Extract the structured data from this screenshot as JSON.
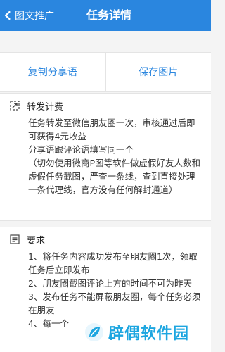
{
  "header": {
    "back_label": "图文推广",
    "title": "任务详情"
  },
  "actions": {
    "copy_label": "复制分享语",
    "save_label": "保存图片"
  },
  "fee_section": {
    "title": "转发计费",
    "lines": [
      "任务转发至微信朋友圈一次，审核通过后即可获得4元收益",
      "分享语跟评论语填写同一个",
      "（切勿使用微商P图等软件做虚假好友人数和虚假任务截图，严查一条线，查到直接处理一条代理线，官方没有任何解封通道）"
    ]
  },
  "req_section": {
    "title": "要求",
    "lines": [
      "1、将任务内容成功发布至朋友圈1次，领取任务后立即发布",
      "2、朋友圈截图评论上方的时间不可为昨天",
      "3、发布任务不能屏蔽朋友圈，每个任务必须在朋友",
      "4、每一个"
    ]
  },
  "watermark": {
    "text": "辟偶软件园"
  }
}
